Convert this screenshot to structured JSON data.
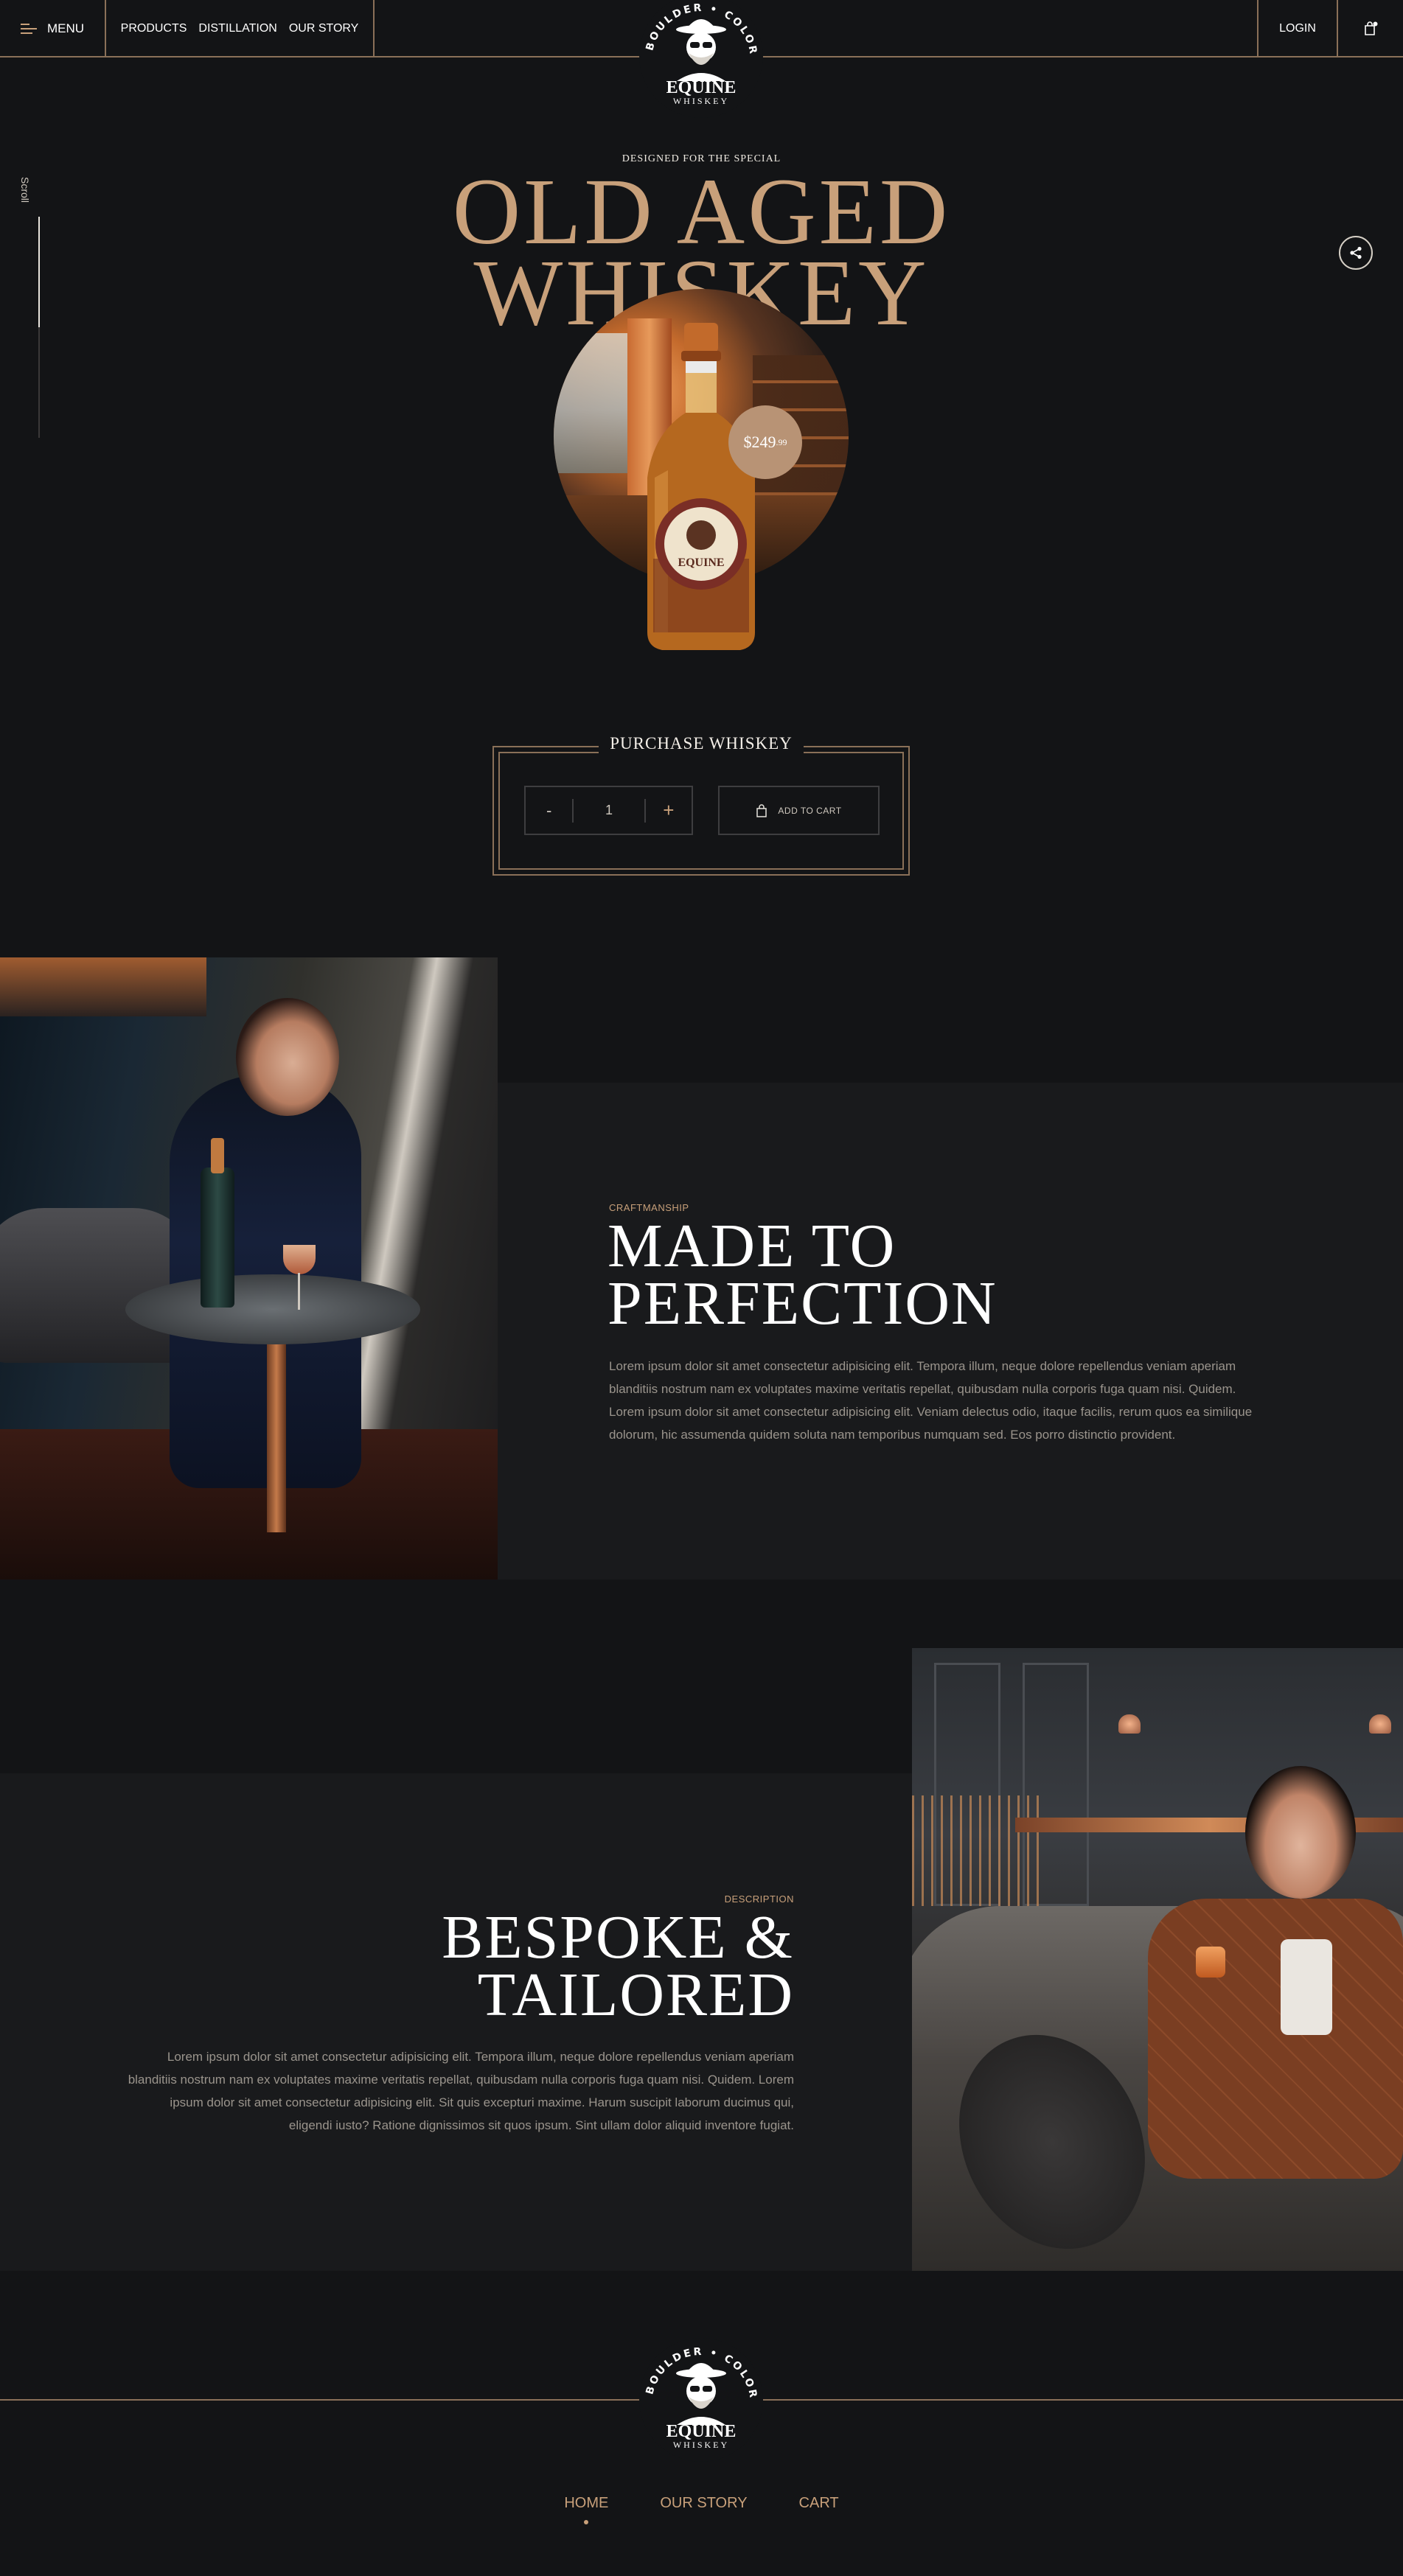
{
  "header": {
    "menu_label": "MENU",
    "nav": [
      "PRODUCTS",
      "DISTILLATION",
      "OUR STORY"
    ],
    "login_label": "LOGIN",
    "icons": {
      "menu": "hamburger-icon",
      "cart": "bag-icon",
      "share": "share-icon"
    }
  },
  "brand": {
    "ring_text": "BOULDER • COLORADO •",
    "name": "EQUINE",
    "tagline": "WHISKEY"
  },
  "scroll_label": "Scroll",
  "hero": {
    "eyebrow": "DESIGNED FOR THE SPECIAL",
    "title_line1": "OLD AGED",
    "title_line2": "WHISKEY",
    "price_main": "$249",
    "price_cents": ".99"
  },
  "purchase": {
    "title": "PURCHASE WHISKEY",
    "minus": "-",
    "quantity": "1",
    "plus": "+",
    "add_to_cart": "ADD TO CART"
  },
  "craftsmanship": {
    "eyebrow": "CRAFTMANSHIP",
    "title_line1": "MADE TO",
    "title_line2": "PERFECTION",
    "body": "Lorem ipsum dolor sit amet consectetur adipisicing elit. Tempora illum, neque dolore repellendus veniam aperiam blanditiis nostrum nam ex voluptates maxime veritatis repellat, quibusdam nulla corporis fuga quam nisi. Quidem. Lorem ipsum dolor sit amet consectetur adipisicing elit. Veniam delectus odio, itaque facilis, rerum quos ea similique dolorum, hic assumenda quidem soluta nam temporibus numquam sed. Eos porro distinctio provident."
  },
  "bespoke": {
    "eyebrow": "DESCRIPTION",
    "title_line1": "BESPOKE &",
    "title_line2": "TAILORED",
    "body": "Lorem ipsum dolor sit amet consectetur adipisicing elit. Tempora illum, neque dolore repellendus veniam aperiam blanditiis nostrum nam ex voluptates maxime veritatis repellat, quibusdam nulla corporis fuga quam nisi. Quidem. Lorem ipsum dolor sit amet consectetur adipisicing elit. Sit quis excepturi maxime. Harum suscipit laborum ducimus qui, eligendi iusto? Ratione dignissimos sit quos ipsum. Sint ullam dolor aliquid inventore fugiat."
  },
  "footer": {
    "nav": [
      "HOME",
      "OUR STORY",
      "CART"
    ],
    "active": "HOME"
  },
  "colors": {
    "accent": "#c8a07a",
    "background": "#131416",
    "panel": "#191a1c"
  }
}
